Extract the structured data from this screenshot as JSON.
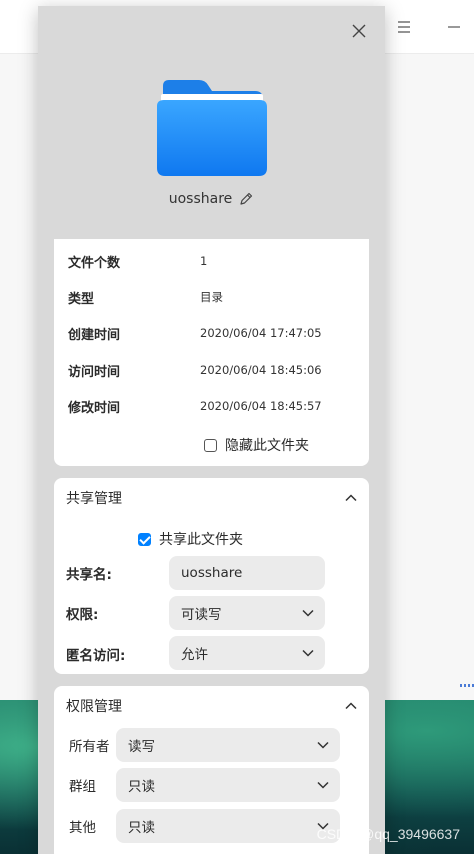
{
  "background": {
    "menu_icon": "menu-icon",
    "minimize_icon": "minimize-icon"
  },
  "dialog": {
    "folder_name": "uosshare",
    "basic_info": {
      "rows": [
        {
          "label": "文件个数",
          "value": "1"
        },
        {
          "label": "类型",
          "value": "目录"
        },
        {
          "label": "创建时间",
          "value": "2020/06/04 17:47:05"
        },
        {
          "label": "访问时间",
          "value": "2020/06/04 18:45:06"
        },
        {
          "label": "修改时间",
          "value": "2020/06/04 18:45:57"
        }
      ],
      "hide_folder_label": "隐藏此文件夹",
      "hide_folder_checked": false
    },
    "share": {
      "title": "共享管理",
      "share_checkbox_label": "共享此文件夹",
      "share_checked": true,
      "share_name_label": "共享名:",
      "share_name_value": "uosshare",
      "permission_label": "权限:",
      "permission_value": "可读写",
      "anonymous_label": "匿名访问:",
      "anonymous_value": "允许"
    },
    "permissions": {
      "title": "权限管理",
      "owner_label": "所有者",
      "owner_value": "读写",
      "group_label": "群组",
      "group_value": "只读",
      "other_label": "其他",
      "other_value": "只读"
    }
  },
  "watermark": "CSDN @qq_39496637",
  "colors": {
    "accent": "#0081ff",
    "folder_blue": "#1e8cff"
  }
}
